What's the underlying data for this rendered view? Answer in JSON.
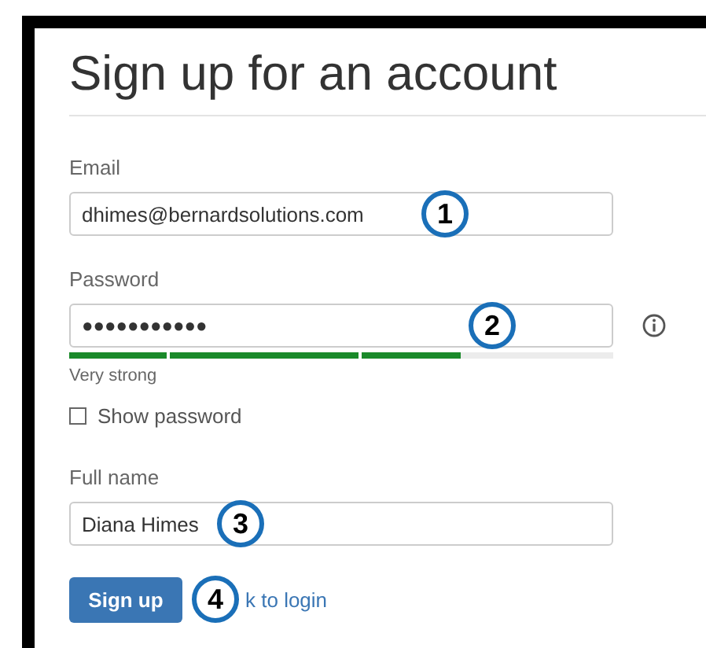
{
  "title": "Sign up for an account",
  "fields": [
    {
      "kind": "text",
      "label": "Email",
      "value": "dhimes@bernardsolutions.com",
      "callout": "1"
    },
    {
      "kind": "password",
      "label": "Password",
      "value": "●●●●●●●●●●●",
      "callout": "2",
      "strength": {
        "level": 0.72,
        "label": "Very strong"
      }
    },
    {
      "kind": "checkbox",
      "label": "Show password",
      "checked": false
    },
    {
      "kind": "text",
      "label": "Full name",
      "value": "Diana Himes",
      "callout": "3"
    }
  ],
  "actions": {
    "button": "Sign up",
    "link": "k to login",
    "callout": "4"
  }
}
